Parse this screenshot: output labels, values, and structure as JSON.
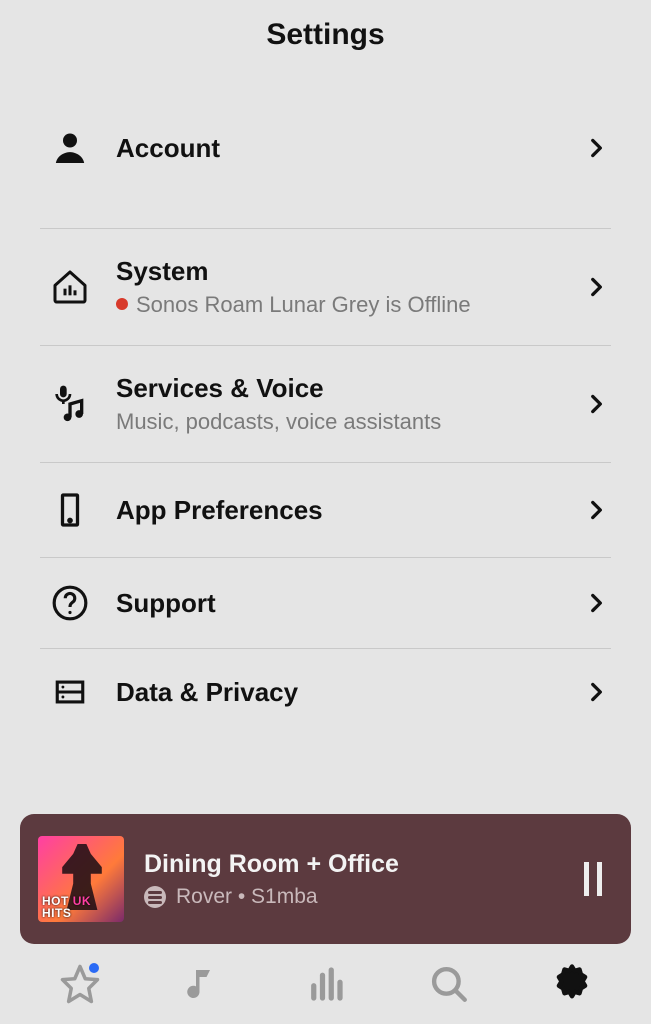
{
  "header": {
    "title": "Settings"
  },
  "rows": {
    "account": {
      "title": "Account"
    },
    "system": {
      "title": "System",
      "subtitle": "Sonos Roam Lunar Grey is Offline"
    },
    "services": {
      "title": "Services & Voice",
      "subtitle": "Music, podcasts, voice assistants"
    },
    "appprefs": {
      "title": "App Preferences"
    },
    "support": {
      "title": "Support"
    },
    "data": {
      "title": "Data & Privacy"
    }
  },
  "nowPlaying": {
    "room": "Dining Room + Office",
    "track": "Rover • S1mba",
    "albumText1": "HOT",
    "albumText2": "UK",
    "albumText3": "HITS"
  },
  "colors": {
    "statusDot": "#d83a2b",
    "miniPlayerBg": "#5c3a3f",
    "badge": "#2a6af5"
  }
}
